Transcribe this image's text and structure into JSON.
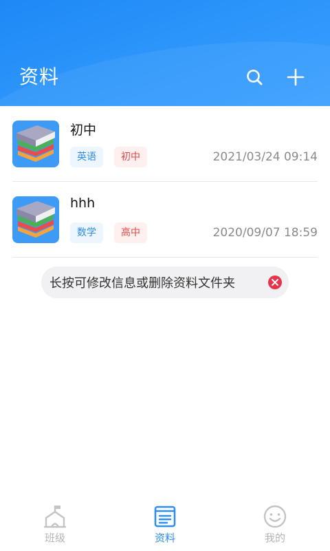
{
  "header": {
    "title": "资料",
    "search_icon": "search-icon",
    "add_icon": "plus-icon",
    "accent": "#2a92f8"
  },
  "items": [
    {
      "title": "初中",
      "subject_tag": "英语",
      "level_tag": "初中",
      "date": "2021/03/24 09:14",
      "icon": "books-stack-icon"
    },
    {
      "title": "hhh",
      "subject_tag": "数学",
      "level_tag": "高中",
      "date": "2020/09/07 18:59",
      "icon": "books-stack-icon"
    }
  ],
  "hint": {
    "text": "长按可修改信息或删除资料文件夹",
    "close_icon": "close-circle-icon"
  },
  "tabs": [
    {
      "label": "班级",
      "icon": "house-flag-icon",
      "active": false
    },
    {
      "label": "资料",
      "icon": "document-icon",
      "active": true
    },
    {
      "label": "我的",
      "icon": "smiley-icon",
      "active": false
    }
  ]
}
